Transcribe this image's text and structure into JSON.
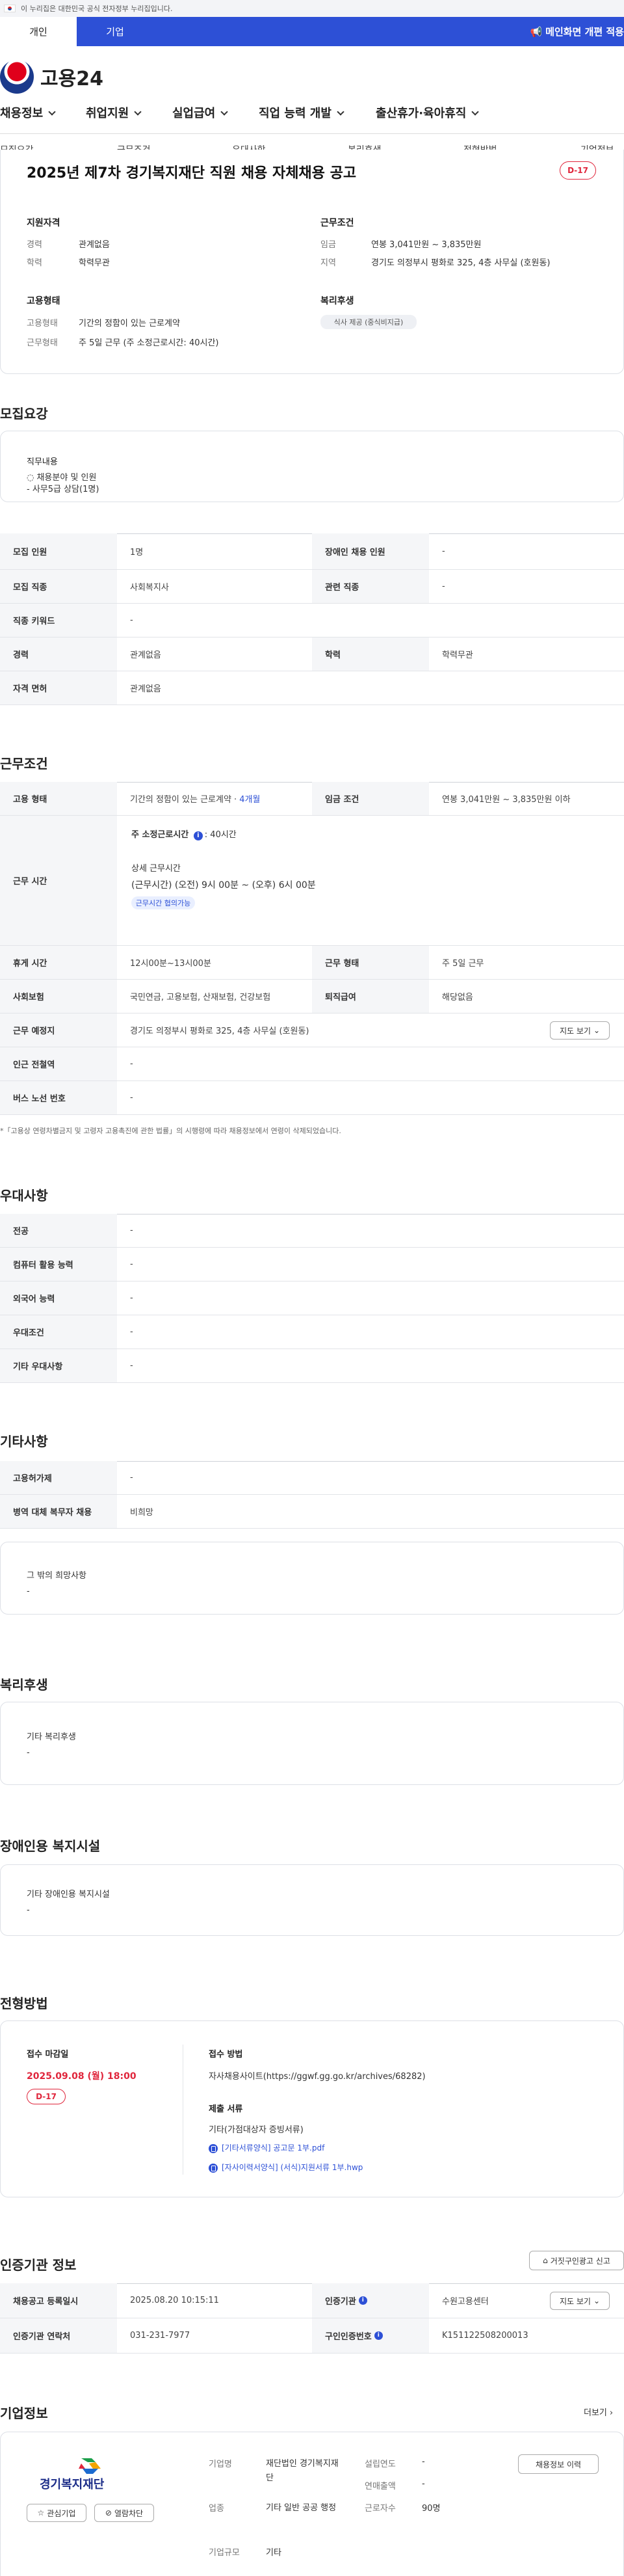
{
  "top_notice": "이 누리집은 대한민국 공식 전자정부 누리집입니다.",
  "tabs": [
    "개인",
    "기업"
  ],
  "promo": "메인화면 개편 적용",
  "logo_text": "고용24",
  "gnb": [
    "채용정보",
    "취업지원",
    "실업급여",
    "직업 능력 개발",
    "출산휴가·육아휴직"
  ],
  "subnav": [
    "모집요강",
    "근무조건",
    "우대사항",
    "복리후생",
    "전형방법",
    "기업정보"
  ],
  "summary": {
    "title": "2025년 제7차 경기복지재단 직원 채용 자체채용 공고",
    "dday": "D-17",
    "qual_h": "지원자격",
    "qual": [
      [
        "경력",
        "관계없음"
      ],
      [
        "학력",
        "학력무관"
      ]
    ],
    "cond_h": "근무조건",
    "cond": [
      [
        "임금",
        "연봉 3,041만원 ~ 3,835만원"
      ],
      [
        "지역",
        "경기도 의정부시 평화로 325, 4층 사무실 (호원동)"
      ]
    ],
    "emp_h": "고용형태",
    "emp": [
      [
        "고용형태",
        "기간의 정함이 있는 근로계약"
      ],
      [
        "근무형태",
        "주 5일 근무 (주 소정근로시간: 40시간)"
      ]
    ],
    "welfare_h": "복리후생",
    "welfare_badge": "식사 제공 (중식비지급)"
  },
  "recruit": {
    "heading": "모집요강",
    "duty_h": "직무내용",
    "duty_lines": [
      "◌ 채용분야 및 인원",
      "- 사무5급 상담(1명)"
    ],
    "rows": [
      [
        [
          "모집 인원",
          "1명"
        ],
        [
          "장애인 채용 인원",
          "-"
        ]
      ],
      [
        [
          "모집 직종",
          "사회복지사"
        ],
        [
          "관련 직종",
          "-"
        ]
      ],
      [
        [
          "직종 키워드",
          "-"
        ]
      ],
      [
        [
          "경력",
          "관계없음"
        ],
        [
          "학력",
          "학력무관"
        ]
      ],
      [
        [
          "자격 면허",
          "관계없음"
        ]
      ]
    ]
  },
  "work": {
    "heading": "근무조건",
    "emp_type_label": "고용 형태",
    "emp_type_value": "기간의 정함이 있는 근로계약 · ",
    "emp_type_period": "4개월",
    "wage_label": "임금 조건",
    "wage_value": "연봉 3,041만원 ~ 3,835만원 이하",
    "hours_label": "근무 시간",
    "hours_weekly": "주 소정근로시간 ",
    "hours_weekly_val": ": 40시간",
    "hours_detail_h": "상세 근무시간",
    "hours_detail": "(근무시간) (오전) 9시 00분 ~ (오후) 6시 00분",
    "hours_badge": "근무시간 협의가능",
    "rows": [
      [
        [
          "휴게 시간",
          "12시00분~13시00분"
        ],
        [
          "근무 형태",
          "주 5일 근무"
        ]
      ],
      [
        [
          "사회보험",
          "국민연금, 고용보험, 산재보험, 건강보험"
        ],
        [
          "퇴직급여",
          "해당없음"
        ]
      ]
    ],
    "place_label": "근무 예정지",
    "place_value": "경기도 의정부시 평화로 325, 4층 사무실 (호원동)",
    "map_btn": "지도 보기",
    "station_label": "인근 전철역",
    "station_value": "-",
    "bus_label": "버스 노선 번호",
    "bus_value": "-",
    "note": "*「고용상 연령차별금지 및 고령자 고용촉진에 관한 법률」의 시행령에 따라 채용정보에서 연령이 삭제되었습니다."
  },
  "pref": {
    "heading": "우대사항",
    "rows": [
      [
        "전공",
        "-"
      ],
      [
        "컴퓨터 활용 능력",
        "-"
      ],
      [
        "외국어 능력",
        "-"
      ],
      [
        "우대조건",
        "-"
      ],
      [
        "기타 우대사항",
        "-"
      ]
    ]
  },
  "etc": {
    "heading": "기타사항",
    "rows": [
      [
        "고용허가제",
        "-"
      ],
      [
        "병역 대체 복무자 채용",
        "비희망"
      ]
    ],
    "box_h": "그 밖의 희망사항",
    "box_v": "-"
  },
  "welfare": {
    "heading": "복리후생",
    "box_h": "기타 복리후생",
    "box_v": "-"
  },
  "disabled": {
    "heading": "장애인용 복지시설",
    "box_h": "기타 장애인용 복지시설",
    "box_v": "-"
  },
  "screening": {
    "heading": "전형방법",
    "deadline_h": "접수 마감일",
    "deadline": "2025.09.08 (월) 18:00",
    "dday": "D-17",
    "method_h": "접수 방법",
    "method": "자사채용사이트(https://ggwf.gg.go.kr/archives/68282)",
    "docs_h": "제출 서류",
    "docs": "기타(가점대상자 증빙서류)",
    "files": [
      "[기타서류양식] 공고문 1부.pdf",
      "[자사이력서양식] (서식)지원서류 1부.hwp"
    ]
  },
  "cert": {
    "heading": "인증기관 정보",
    "report_btn": "거짓구인광고 신고",
    "reg_label": "채용공고 등록일시",
    "reg_value": "2025.08.20 10:15:11",
    "org_label": "인증기관",
    "org_value": "수원고용센터",
    "map_btn": "지도 보기",
    "tel_label": "인증기관 연락처",
    "tel_value": "031-231-7977",
    "no_label": "구인인증번호",
    "no_value": "K151122508200013"
  },
  "company": {
    "heading": "기업정보",
    "more": "더보기",
    "logo_text": "경기복지재단",
    "interest_btn": "관심기업",
    "block_btn": "열람차단",
    "fields_left": [
      [
        "기업명",
        "재단법인 경기복지재단"
      ],
      [
        "업종",
        "기타 일반 공공 행정"
      ],
      [
        "기업규모",
        "기타"
      ]
    ],
    "fields_right": [
      [
        "설립연도",
        "-"
      ],
      [
        "연매출액",
        "-"
      ],
      [
        "근로자수",
        "90명"
      ]
    ],
    "history_btn": "채용정보 이력"
  },
  "colors": {
    "brand": "#2d50d6",
    "alert": "#e0263c"
  }
}
